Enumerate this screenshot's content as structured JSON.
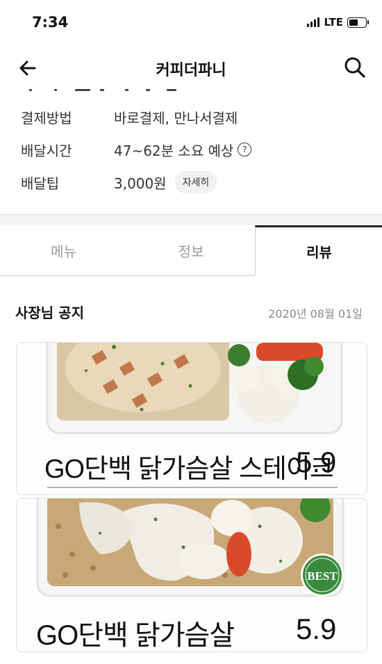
{
  "status_bar": {
    "time": "7:34",
    "network": "LTE",
    "battery_level": 0.55
  },
  "header": {
    "title": "커피더파니",
    "back_icon": "arrow-left-icon",
    "search_icon": "search-icon"
  },
  "info": {
    "payment_label": "결제방법",
    "payment_value": "바로결제, 만나서결제",
    "delivery_time_label": "배달시간",
    "delivery_time_value": "47~62분 소요 예상",
    "delivery_time_help": "?",
    "delivery_tip_label": "배달팁",
    "delivery_tip_value": "3,000원",
    "delivery_tip_detail": "자세히"
  },
  "tabs": {
    "menu": "메뉴",
    "info": "정보",
    "review": "리뷰",
    "active": "리뷰"
  },
  "notice": {
    "title": "사장님 공지",
    "date": "2020년 08월 01일"
  },
  "products": [
    {
      "name": "GO단백 닭가슴살 스테이크",
      "price": "5.9"
    },
    {
      "name": "GO단백 닭가슴살",
      "price": "5.9",
      "badge": "BEST"
    }
  ],
  "colors": {
    "badge_green": "#3a8a3c",
    "active_tab": "#222222"
  }
}
